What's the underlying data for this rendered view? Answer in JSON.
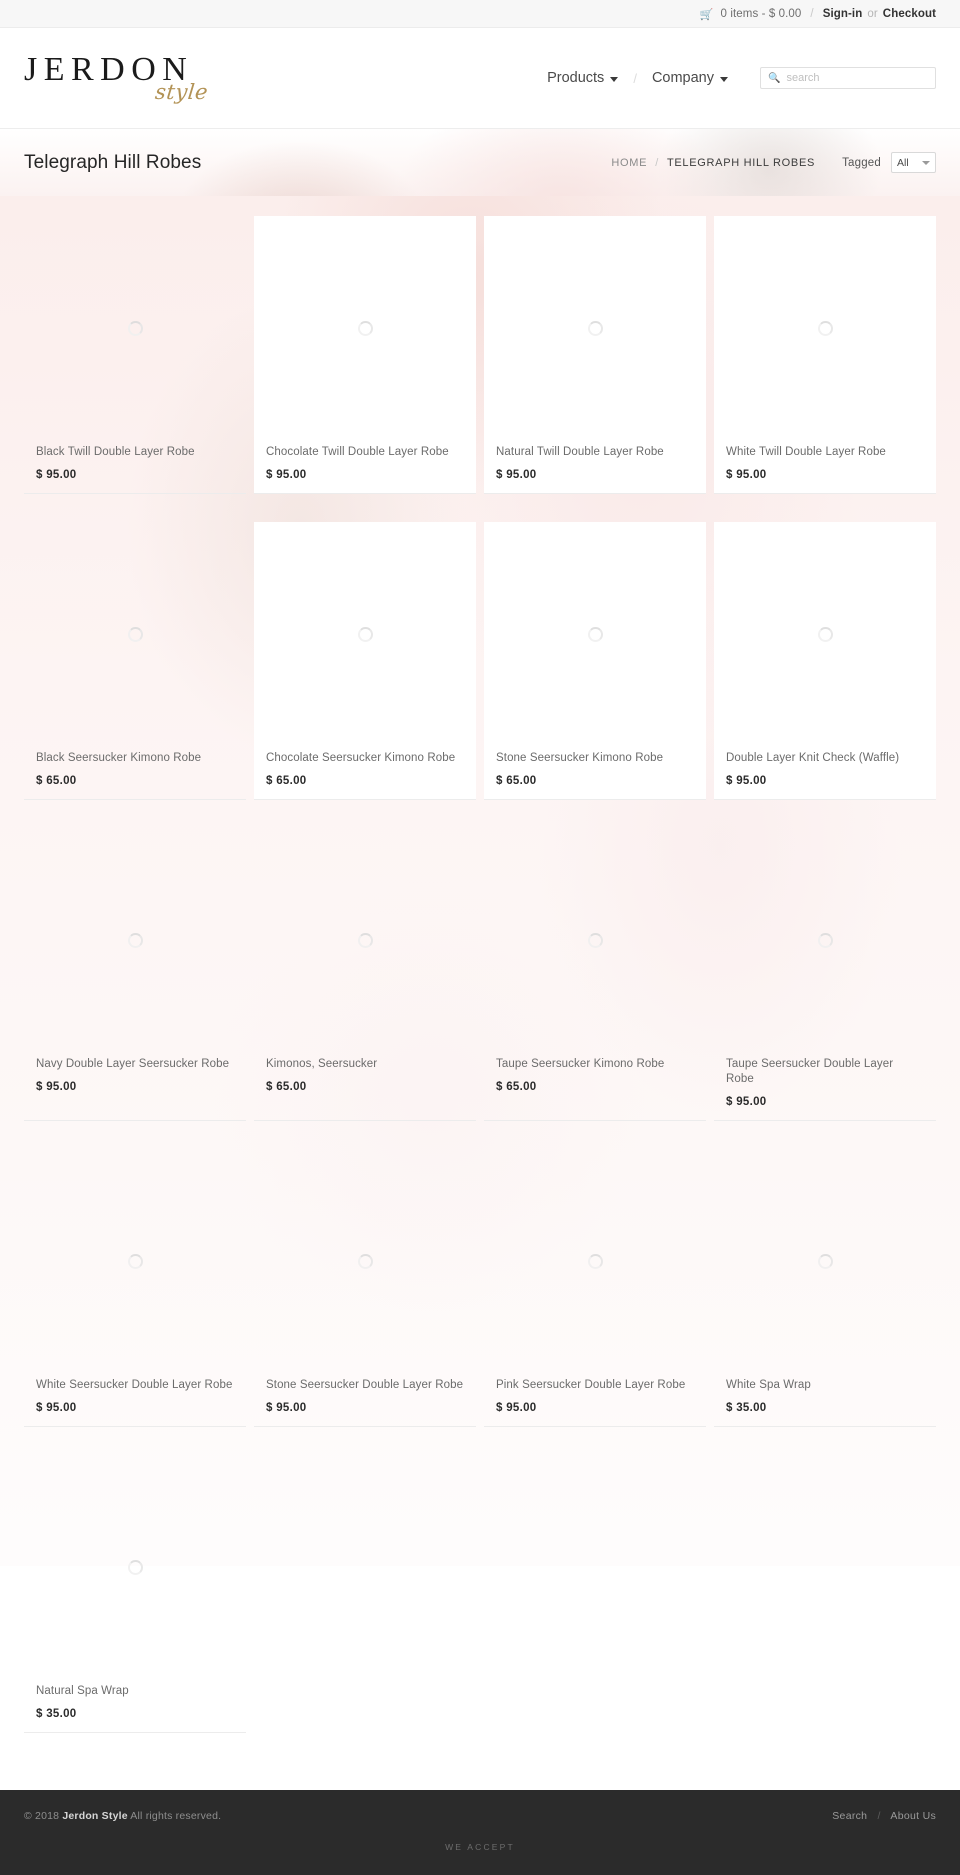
{
  "topbar": {
    "cart_icon": "cart-icon",
    "cart_text": "0 items - $ 0.00",
    "separator": "/",
    "signin": "Sign-in",
    "or": "or",
    "checkout": "Checkout"
  },
  "header": {
    "logo_main": "JERDON",
    "logo_sub": "style",
    "nav": [
      {
        "label": "Products",
        "has_caret": true
      },
      {
        "label": "Company",
        "has_caret": true
      }
    ],
    "nav_separator": "/",
    "search": {
      "icon": "search-icon",
      "placeholder": "search",
      "value": ""
    }
  },
  "titlebar": {
    "title": "Telegraph Hill Robes",
    "breadcrumb": [
      {
        "label": "HOME",
        "current": false
      },
      {
        "label": "TELEGRAPH HILL ROBES",
        "current": true
      }
    ],
    "breadcrumb_separator": "/",
    "tagged_label": "Tagged",
    "tagged_value": "All",
    "tagged_options": [
      "All"
    ]
  },
  "products": [
    {
      "name": "Black Twill Double Layer Robe",
      "price": "$ 95.00"
    },
    {
      "name": "Chocolate Twill Double Layer Robe",
      "price": "$ 95.00"
    },
    {
      "name": "Natural Twill Double Layer Robe",
      "price": "$ 95.00"
    },
    {
      "name": "White Twill Double Layer Robe",
      "price": "$ 95.00"
    },
    {
      "name": "Black Seersucker Kimono Robe",
      "price": "$ 65.00"
    },
    {
      "name": "Chocolate Seersucker Kimono Robe",
      "price": "$ 65.00"
    },
    {
      "name": "Stone Seersucker Kimono Robe",
      "price": "$ 65.00"
    },
    {
      "name": "Double Layer Knit Check (Waffle)",
      "price": "$ 95.00"
    },
    {
      "name": "Navy Double Layer Seersucker Robe",
      "price": "$ 95.00"
    },
    {
      "name": "Kimonos, Seersucker",
      "price": "$ 65.00"
    },
    {
      "name": "Taupe Seersucker Kimono Robe",
      "price": "$ 65.00"
    },
    {
      "name": "Taupe Seersucker Double Layer Robe",
      "price": "$ 95.00"
    },
    {
      "name": "White Seersucker Double Layer Robe",
      "price": "$ 95.00"
    },
    {
      "name": "Stone Seersucker Double Layer Robe",
      "price": "$ 95.00"
    },
    {
      "name": "Pink Seersucker Double Layer Robe",
      "price": "$ 95.00"
    },
    {
      "name": "White Spa Wrap",
      "price": "$ 35.00"
    },
    {
      "name": "Natural Spa Wrap",
      "price": "$ 35.00"
    }
  ],
  "footer": {
    "copyright_prefix": "© 2018 ",
    "brand": "Jerdon Style",
    "copyright_suffix": " All rights reserved.",
    "links": [
      {
        "label": "Search"
      },
      {
        "label": "About Us"
      }
    ],
    "links_separator": "/",
    "we_accept": "WE ACCEPT"
  },
  "colors": {
    "gold": "#b39356",
    "footer_bg": "#2b2b2b",
    "text_dark": "#2b2b2b",
    "text_muted": "#6b6b6b"
  }
}
